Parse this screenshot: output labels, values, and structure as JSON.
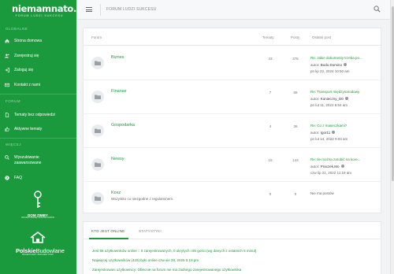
{
  "sidebar": {
    "logo": "niemamnato.",
    "tagline": "FORUM LUDZI SUKCESU",
    "section_global": "GLOBALNE",
    "items_global": [
      "Strona domowa",
      "Zarejestruj się",
      "Zaloguj się",
      "Kontakt z nami"
    ],
    "section_forum": "FORUM",
    "items_forum": [
      "Tematy bez odpowiedzi",
      "Aktywne tematy"
    ],
    "section_more": "WIĘCEJ",
    "items_more": [
      "Wyszukiwanie zaawansowane",
      "FAQ"
    ],
    "badge1_title": "DOM ZIMBY",
    "badge1_sub": "PROJEKTOWANIE I BUDOWA DOMÓW",
    "badge2_part1": "Polskie",
    "badge2_part2": "Budowlane",
    "badge2_sub": "PROJEKTUJEMY I BUDUJEMY DOMY"
  },
  "header": {
    "breadcrumb": "FORUM LUDZI SUKCESU"
  },
  "forum_table": {
    "headers": {
      "forum": "Forum",
      "topics": "Tematy",
      "posts": "Posty",
      "last": "Ostatni post"
    },
    "rows": [
      {
        "name": "Biznes",
        "desc": "",
        "topics": "33",
        "posts": "376",
        "last_title": "Re: Jakie dokumenty trzeba po...",
        "last_author_label": "autor:",
        "last_author": "Bodo.Domino",
        "last_date": "pn lip 22, 2024 10:50 am"
      },
      {
        "name": "Finanse",
        "desc": "",
        "topics": "7",
        "posts": "68",
        "last_title": "Re: Transport międzynarodowy",
        "last_author_label": "autor:",
        "last_author": "Konieczny_D0",
        "last_date": "pn lut 11, 2022 6:54 am"
      },
      {
        "name": "Gospodarka",
        "desc": "",
        "topics": "4",
        "posts": "36",
        "last_title": "Re: Co z maseczkami?",
        "last_author_label": "autor:",
        "last_author": "Igor11",
        "last_date": "pn lut 14, 2022 9:03 am"
      },
      {
        "name": "Newsy",
        "desc": "",
        "topics": "15",
        "posts": "144",
        "last_title": "Re: Ile można zarobić na kore...",
        "last_author_label": "autor:",
        "last_author": "Praczek.Mo",
        "last_date": "czw lip 21, 2022 11:19 am"
      },
      {
        "name": "Kosz",
        "desc": "Wszystko co niezgodne z regulaminem.",
        "topics": "0",
        "posts": "0",
        "last_title": "Nie ma postów",
        "last_author_label": "",
        "last_author": "",
        "last_date": ""
      }
    ]
  },
  "online": {
    "tab_active": "KTO JEST ONLINE",
    "tab_stats": "STATYSTYKI",
    "line1": "Jest 86 użytkowników online :: 0 zarejestrowanych, 0 ukrytych i 86 gości (wg danych z ostatnich 5 minut)",
    "line2": "Najwięcej użytkowników (429) było online czw sie 28, 2025 5:18 pm",
    "line3": "Zarejestrowani użytkownicy: Obecnie na forum nie ma żadnego zarejestrowanego użytkownika"
  },
  "colors": {
    "brand_green": "#1a9a3c",
    "accent_link": "#1a9a3c"
  }
}
